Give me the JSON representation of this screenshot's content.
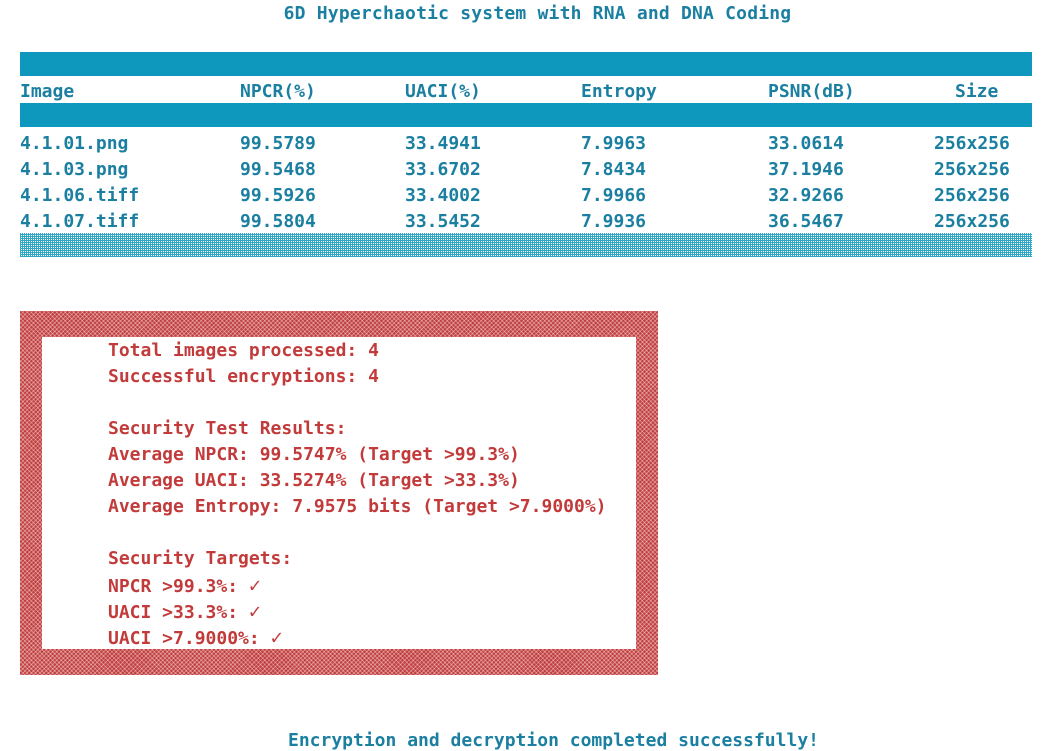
{
  "title": "6D Hyperchaotic system with RNA and DNA Coding",
  "table": {
    "headers": [
      "Image",
      "NPCR(%)",
      "UACI(%)",
      "Entropy",
      "PSNR(dB)",
      "Size"
    ],
    "rows": [
      [
        "4.1.01.png",
        "99.5789",
        "33.4941",
        "7.9963",
        "33.0614",
        "256x256"
      ],
      [
        "4.1.03.png",
        "99.5468",
        "33.6702",
        "7.8434",
        "37.1946",
        "256x256"
      ],
      [
        "4.1.06.tiff",
        "99.5926",
        "33.4002",
        "7.9966",
        "32.9266",
        "256x256"
      ],
      [
        "4.1.07.tiff",
        "99.5804",
        "33.5452",
        "7.9936",
        "36.5467",
        "256x256"
      ]
    ]
  },
  "summary": {
    "total": "Total images processed: 4",
    "successful": "Successful encryptions: 4",
    "results_heading": "Security Test Results:",
    "avg_npcr": "Average NPCR: 99.5747% (Target >99.3%)",
    "avg_uaci": "Average UACI: 33.5274% (Target >33.3%)",
    "avg_entropy": "Average Entropy: 7.9575 bits (Target >7.9000%)",
    "targets_heading": "Security Targets:",
    "target_npcr": "NPCR >99.3%: ",
    "target_uaci": "UACI >33.3%: ",
    "target_entropy": "UACI >7.9000%: ",
    "check_mark": "✓"
  },
  "footer": "Encryption and decryption completed successfully!",
  "colors": {
    "teal_text": "#1a7fa0",
    "teal_bar": "#0e98bd",
    "red": "#c23a3a"
  }
}
